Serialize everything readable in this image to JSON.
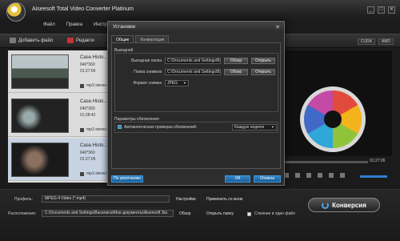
{
  "app": {
    "title": "Aiseesoft Total Video Converter Platinum",
    "menu": [
      "Файл",
      "Правка",
      "Инструме"
    ],
    "window_controls": [
      "_",
      "□",
      "✕"
    ]
  },
  "toolbar": {
    "add_file": "Добавить файл",
    "edit": "Редакти",
    "cuda": "CUDA",
    "amd": "AMD"
  },
  "files": [
    {
      "name": "Case.Histo…Studi",
      "resolution": "640*360",
      "duration": "01:27:00",
      "audio": "mp3 stereo (0x"
    },
    {
      "name": "Case.Histo…Studi",
      "resolution": "640*360",
      "duration": "01:28:42",
      "audio": "mp3 stereo (0x"
    },
    {
      "name": "Case.Histo…Studi",
      "resolution": "640*360",
      "duration": "01:27:05",
      "audio": "mp3 stereo (0x"
    }
  ],
  "preview": {
    "time": "01:27:26"
  },
  "bottom": {
    "profile_label": "Профиль:",
    "profile_value": "MPEG-4 Video (*.mp4)",
    "settings": "Настройки",
    "apply_all": "Применить со всем",
    "dest_label": "Расположение:",
    "dest_value": "C:\\Documents and Settings\\Василиса\\Мои документы\\Aiseesoft Stu",
    "browse": "Обзор",
    "open_folder": "Открыть папку",
    "merge": "Слияние в один файл",
    "convert": "Конверсия"
  },
  "dialog": {
    "title": "Установки",
    "close": "✕",
    "tabs": [
      "Общие",
      "Конвертация"
    ],
    "output_section": "Выходной",
    "fields": [
      {
        "label": "Выходная папка",
        "value": "C:\\Documents and Settings\\Васили",
        "browse": "Обзор",
        "open": "Открыть"
      },
      {
        "label": "Папка снимков",
        "value": "C:\\Documents and Settings\\Васили",
        "browse": "Обзор",
        "open": "Открыть"
      }
    ],
    "snapshot_label": "Формат снимка",
    "snapshot_value": "JPEG",
    "update_section": "Параметры обновления",
    "auto_update_label": "Автоматическая проверка обновлений:",
    "auto_update_value": "Каждую неделю",
    "default_btn": "По умолчанию",
    "ok_btn": "ОК",
    "cancel_btn": "Отмена"
  }
}
